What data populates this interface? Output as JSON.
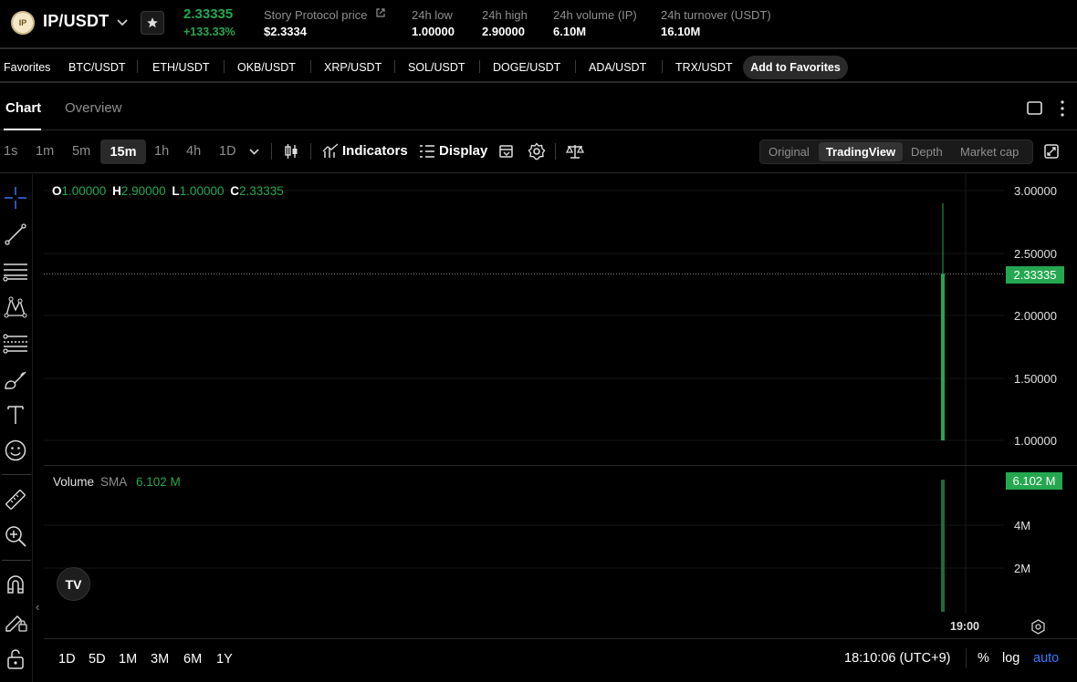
{
  "header": {
    "logo_text": "IP",
    "pair": "IP/USDT",
    "last_price": "2.33335",
    "change_pct": "+133.33%",
    "stats": [
      {
        "label": "Story Protocol price",
        "value": "$2.3334"
      },
      {
        "label": "24h low",
        "value": "1.00000"
      },
      {
        "label": "24h high",
        "value": "2.90000"
      },
      {
        "label": "24h volume (IP)",
        "value": "6.10M"
      },
      {
        "label": "24h turnover (USDT)",
        "value": "16.10M"
      }
    ]
  },
  "favorites": {
    "label": "Favorites",
    "items": [
      "BTC/USDT",
      "ETH/USDT",
      "OKB/USDT",
      "XRP/USDT",
      "SOL/USDT",
      "DOGE/USDT",
      "ADA/USDT",
      "TRX/USDT"
    ],
    "add_label": "Add to Favorites"
  },
  "tabs": [
    {
      "label": "Chart",
      "active": true
    },
    {
      "label": "Overview",
      "active": false
    }
  ],
  "toolbar": {
    "timeframes": [
      "1s",
      "1m",
      "5m",
      "15m",
      "1h",
      "4h",
      "1D"
    ],
    "active_timeframe": "15m",
    "indicators_label": "Indicators",
    "display_label": "Display",
    "views": [
      "Original",
      "TradingView",
      "Depth",
      "Market cap"
    ],
    "active_view": "TradingView"
  },
  "ohlc": {
    "o_key": "O",
    "o_val": "1.00000",
    "h_key": "H",
    "h_val": "2.90000",
    "l_key": "L",
    "l_val": "1.00000",
    "c_key": "C",
    "c_val": "2.33335"
  },
  "price_axis": {
    "ticks": [
      "3.00000",
      "2.50000",
      "2.00000",
      "1.50000",
      "1.00000"
    ],
    "current_tag": "2.33335"
  },
  "volume": {
    "label": "Volume",
    "sma_label": "SMA",
    "sma_value": "6.102 M",
    "tag": "6.102 M",
    "ticks": [
      "4M",
      "2M"
    ]
  },
  "time_axis": {
    "label": "19:00"
  },
  "bottom": {
    "ranges": [
      "1D",
      "5D",
      "1M",
      "3M",
      "6M",
      "1Y"
    ],
    "time_readout": "18:10:06 (UTC+9)",
    "pct_label": "%",
    "log_label": "log",
    "auto_label": "auto"
  },
  "tv_logo_text": "TV",
  "colors": {
    "up": "#25a750",
    "accent_blue": "#3a7bff",
    "background": "#000000"
  },
  "chart_data": {
    "type": "candlestick",
    "interval": "15m",
    "candles": [
      {
        "open": 1.0,
        "high": 2.9,
        "low": 1.0,
        "close": 2.33335,
        "volume": 6102000
      }
    ],
    "price_range": [
      1.0,
      3.0
    ],
    "volume_ticks": [
      "4M",
      "2M"
    ],
    "x_tick_label": "19:00",
    "grid": true
  }
}
